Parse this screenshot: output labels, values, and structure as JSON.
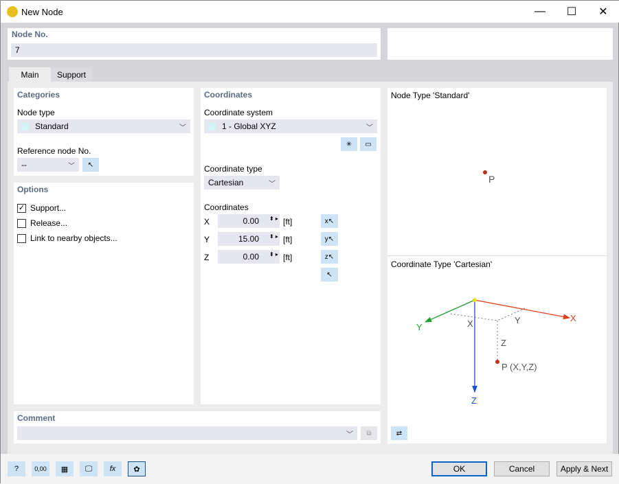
{
  "window": {
    "title": "New Node",
    "minimize": "—",
    "maximize": "☐",
    "close": "✕"
  },
  "node_no": {
    "label": "Node No.",
    "value": "7"
  },
  "tabs": [
    {
      "label": "Main"
    },
    {
      "label": "Support"
    }
  ],
  "categories": {
    "header": "Categories",
    "node_type_label": "Node type",
    "node_type_value": "Standard",
    "ref_label": "Reference node No.",
    "ref_value": "--"
  },
  "options": {
    "header": "Options",
    "items": [
      {
        "label": "Support...",
        "checked": true
      },
      {
        "label": "Release...",
        "checked": false
      },
      {
        "label": "Link to nearby objects...",
        "checked": false
      }
    ]
  },
  "coordinates": {
    "header": "Coordinates",
    "system_label": "Coordinate system",
    "system_value": "1 - Global XYZ",
    "type_label": "Coordinate type",
    "type_value": "Cartesian",
    "coords_label": "Coordinates",
    "rows": [
      {
        "axis": "X",
        "value": "0.00",
        "unit": "[ft]"
      },
      {
        "axis": "Y",
        "value": "15.00",
        "unit": "[ft]"
      },
      {
        "axis": "Z",
        "value": "0.00",
        "unit": "[ft]"
      }
    ]
  },
  "preview": {
    "node_title": "Node Type 'Standard'",
    "point_label": "P",
    "coord_title": "Coordinate Type 'Cartesian'",
    "axes": {
      "x": "X",
      "y": "Y",
      "z": "Z"
    },
    "dim_x": "X",
    "dim_y": "Y",
    "dim_z": "Z",
    "point_coords": "P (X,Y,Z)",
    "colors": {
      "x": "#e0401a",
      "y": "#22a030",
      "z": "#1a50d0"
    }
  },
  "comment": {
    "header": "Comment",
    "value": ""
  },
  "footer": {
    "ok": "OK",
    "cancel": "Cancel",
    "apply_next": "Apply & Next",
    "num_icon_text": "0,00"
  }
}
